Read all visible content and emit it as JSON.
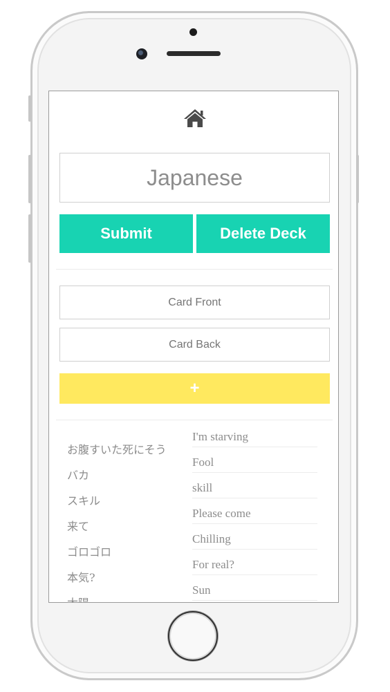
{
  "deck": {
    "name_value": "Japanese",
    "submit_label": "Submit",
    "delete_label": "Delete Deck"
  },
  "new_card": {
    "front_placeholder": "Card Front",
    "back_placeholder": "Card Back",
    "add_label": "+"
  },
  "cards": [
    {
      "front": "お腹すいた死にそう",
      "back": "I'm starving"
    },
    {
      "front": "バカ",
      "back": "Fool"
    },
    {
      "front": "スキル",
      "back": "skill"
    },
    {
      "front": "来て",
      "back": "Please come"
    },
    {
      "front": "ゴロゴロ",
      "back": "Chilling"
    },
    {
      "front": "本気?",
      "back": "For real?"
    },
    {
      "front": "太陽",
      "back": "Sun"
    }
  ],
  "icons": {
    "nav": "home-icon"
  },
  "colors": {
    "primary": "#18d3b2",
    "add": "#ffe95f",
    "home_icon": "#4a4a4a"
  }
}
